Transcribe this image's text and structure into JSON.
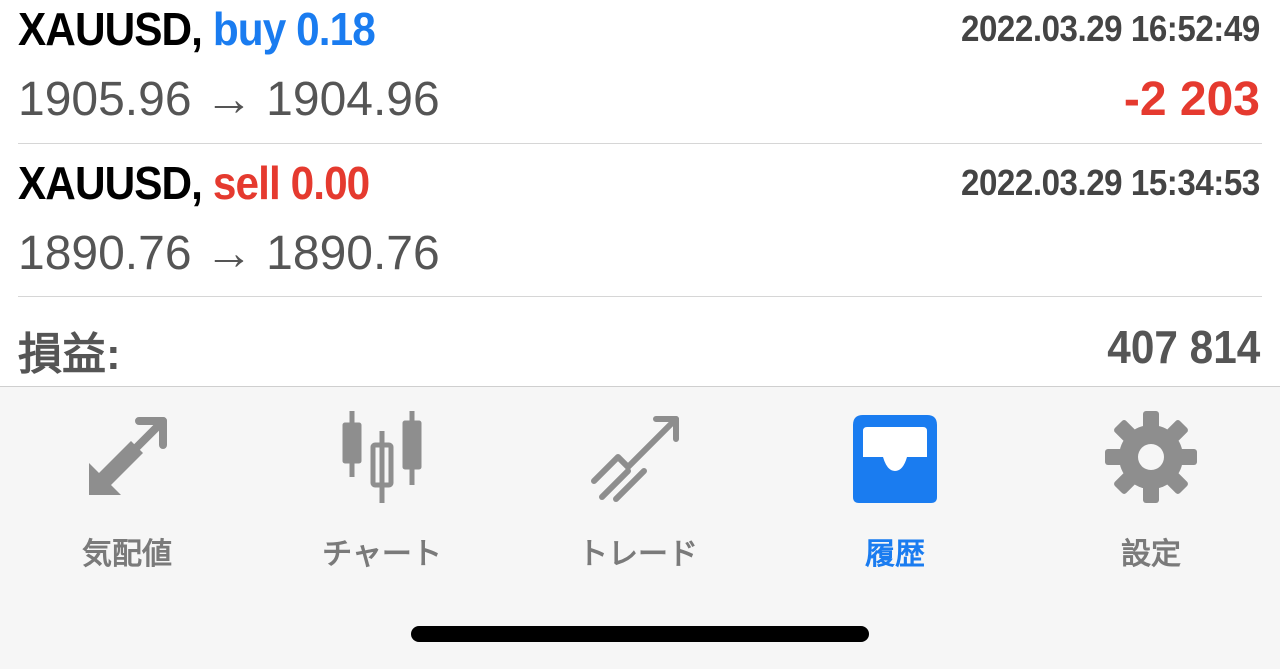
{
  "trades": [
    {
      "symbol": "XAUUSD,",
      "side": "buy 0.18",
      "side_color": "#1a7cf0",
      "time": "2022.03.29 16:52:49",
      "prices": "1905.96 → 1904.96",
      "profit": "-2 203"
    },
    {
      "symbol": "XAUUSD,",
      "side": "sell 0.00",
      "side_color": "#e53a2f",
      "time": "2022.03.29 15:34:53",
      "prices": "1890.76 → 1890.76",
      "profit": ""
    }
  ],
  "summary": {
    "label": "損益:",
    "value": "407 814"
  },
  "tabs": [
    {
      "label": "気配値",
      "icon": "quotes-arrows-icon",
      "active": false
    },
    {
      "label": "チャート",
      "icon": "candlestick-chart-icon",
      "active": false
    },
    {
      "label": "トレード",
      "icon": "trade-trend-icon",
      "active": false
    },
    {
      "label": "履歴",
      "icon": "history-inbox-icon",
      "active": true
    },
    {
      "label": "設定",
      "icon": "settings-gear-icon",
      "active": false
    }
  ],
  "colors": {
    "accent": "#1a7cf0",
    "loss": "#e53a2f",
    "inactive": "#7a7a7a"
  }
}
